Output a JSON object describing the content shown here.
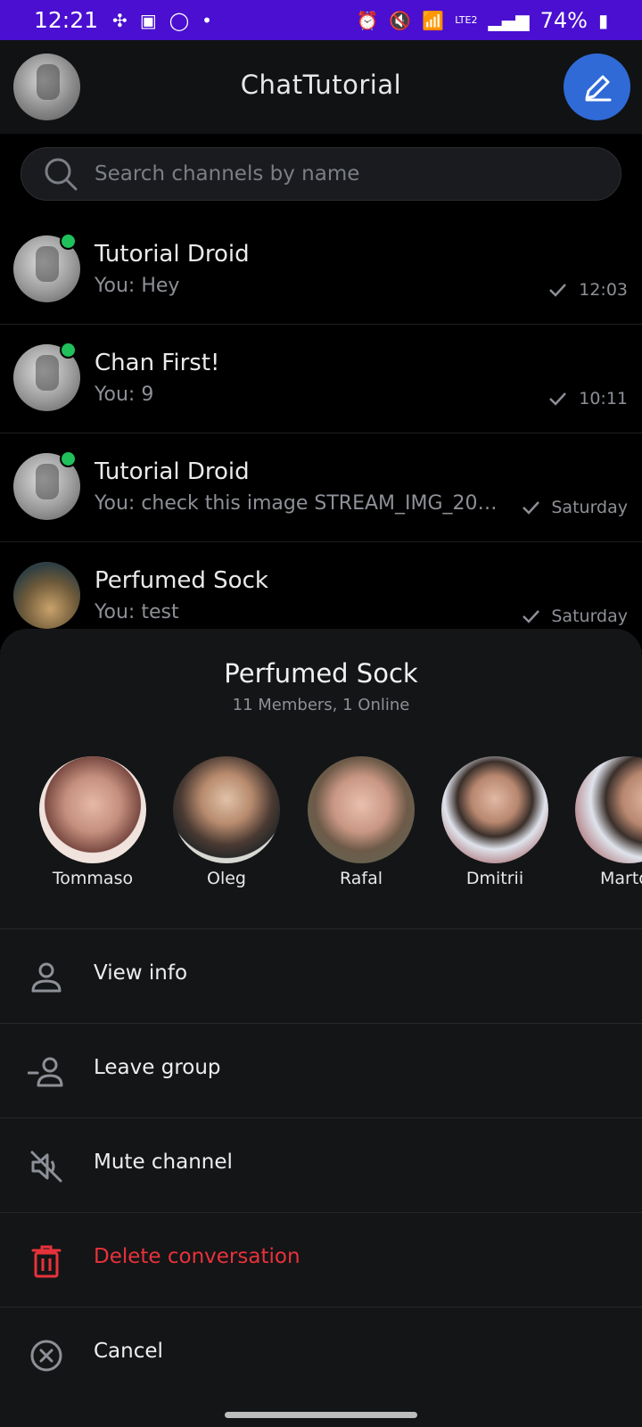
{
  "status_bar": {
    "time": "12:21",
    "battery": "74%",
    "network": "LTE2",
    "icons_left": [
      "pinwheel-icon",
      "gallery-icon",
      "whatsapp-icon",
      "dot-icon"
    ],
    "icons_right": [
      "alarm-icon",
      "mute-icon",
      "wifi-icon",
      "signal-icon",
      "volte-icon",
      "signal-icon",
      "battery-icon"
    ]
  },
  "header": {
    "title": "ChatTutorial"
  },
  "search": {
    "placeholder": "Search channels by name"
  },
  "channels": [
    {
      "name": "Tutorial Droid",
      "last_message": "You: Hey",
      "time": "12:03",
      "online": true
    },
    {
      "name": "Chan First!",
      "last_message": "You: 9",
      "time": "10:11",
      "online": true
    },
    {
      "name": "Tutorial Droid",
      "last_message": "You: check this image STREAM_IMG_20220...",
      "time": "Saturday",
      "online": true
    },
    {
      "name": "Perfumed Sock",
      "last_message": "You: test",
      "time": "Saturday",
      "online": false
    }
  ],
  "sheet": {
    "title": "Perfumed Sock",
    "subtitle": "11 Members, 1 Online",
    "members": [
      {
        "name": "Tommaso"
      },
      {
        "name": "Oleg"
      },
      {
        "name": "Rafal"
      },
      {
        "name": "Dmitrii"
      },
      {
        "name": "Marto"
      }
    ],
    "actions": [
      {
        "label": "View info",
        "icon": "person-icon"
      },
      {
        "label": "Leave group",
        "icon": "leave-group-icon"
      },
      {
        "label": "Mute channel",
        "icon": "mute-icon"
      },
      {
        "label": "Delete conversation",
        "icon": "trash-icon",
        "color": "#e8323b"
      },
      {
        "label": "Cancel",
        "icon": "cancel-icon"
      }
    ]
  },
  "colors": {
    "status_bar": "#4a0fd0",
    "accent": "#2f6ad6",
    "online": "#20c05a",
    "danger": "#e8323b"
  }
}
